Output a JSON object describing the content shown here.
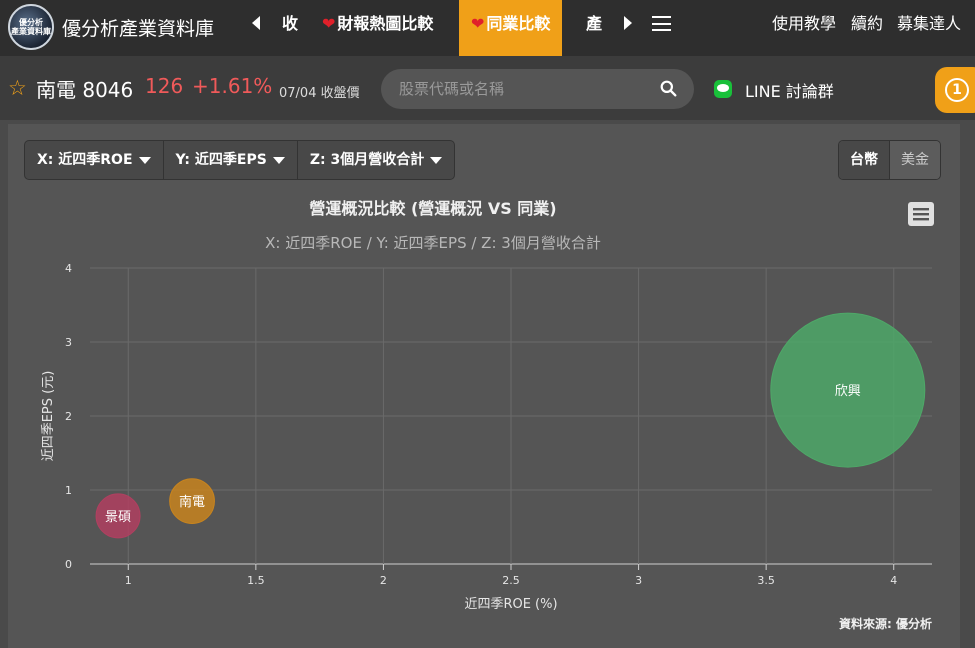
{
  "brand": {
    "logo_line1": "優分析",
    "logo_line2": "產業資料庫",
    "title": "優分析產業資料庫"
  },
  "nav": {
    "items": [
      {
        "label": "收"
      },
      {
        "label": "財報熱圖比較"
      },
      {
        "label": "同業比較"
      },
      {
        "label": "產"
      }
    ],
    "right": [
      "使用教學",
      "續約",
      "募集達人"
    ]
  },
  "stock": {
    "name": "南電 8046",
    "price": "126",
    "change": "+1.61%",
    "date": "07/04 收盤價"
  },
  "search": {
    "placeholder": "股票代碼或名稱"
  },
  "line": {
    "label": "LINE 討論群"
  },
  "notification": {
    "count": "1"
  },
  "selectors": {
    "x": "X: 近四季ROE",
    "y": "Y: 近四季EPS",
    "z": "Z: 3個月營收合計"
  },
  "currency": {
    "twd": "台幣",
    "usd": "美金"
  },
  "colors": {
    "accent": "#f0a018",
    "up": "#f05a5a",
    "grid": "#6a6a6a"
  },
  "chart_data": {
    "type": "scatter",
    "title": "營運概況比較 (營運概況 VS 同業)",
    "subtitle": "X: 近四季ROE / Y: 近四季EPS / Z: 3個月營收合計",
    "xlabel": "近四季ROE (%)",
    "ylabel": "近四季EPS (元)",
    "xlim": [
      0.85,
      4.15
    ],
    "ylim": [
      0,
      4
    ],
    "xticks": [
      "1",
      "1.5",
      "2",
      "2.5",
      "3",
      "3.5",
      "4"
    ],
    "xtick_values": [
      1,
      1.5,
      2,
      2.5,
      3,
      3.5,
      4
    ],
    "yticks": [
      "0",
      "1",
      "2",
      "3",
      "4"
    ],
    "ytick_values": [
      0,
      1,
      2,
      3,
      4
    ],
    "grid": true,
    "legend": "none",
    "credit": "資料來源: 優分析",
    "points": [
      {
        "label": "景碩",
        "x": 0.96,
        "y": 0.65,
        "z": 1,
        "color": "#b04060"
      },
      {
        "label": "南電",
        "x": 1.25,
        "y": 0.85,
        "z": 1.1,
        "color": "#c8841e"
      },
      {
        "label": "欣興",
        "x": 3.82,
        "y": 2.35,
        "z": 13,
        "color": "#4ea868"
      }
    ]
  }
}
